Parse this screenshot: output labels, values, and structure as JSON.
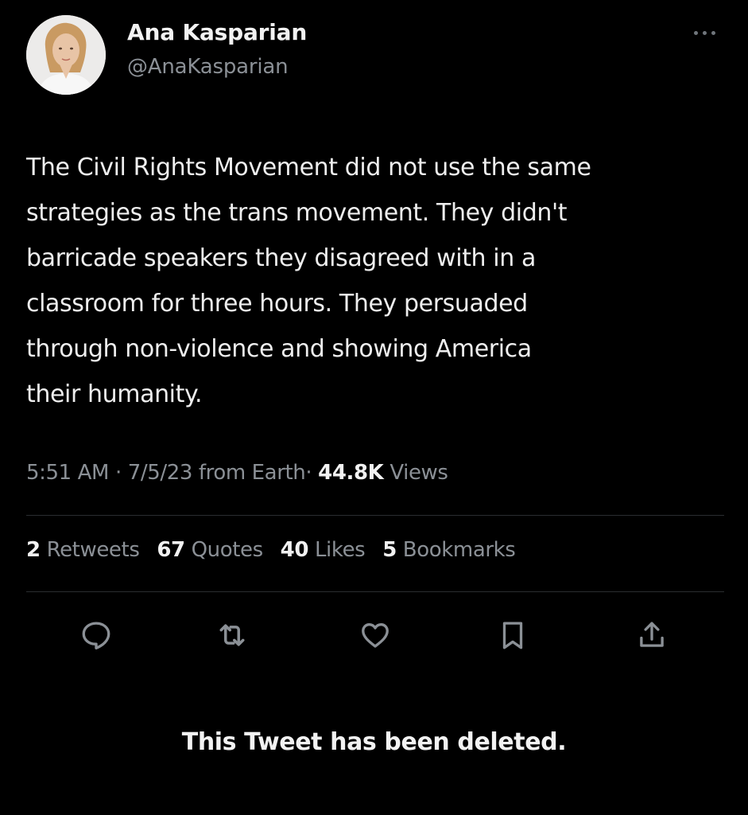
{
  "tweet": {
    "author": {
      "name": "Ana Kasparian",
      "handle": "@AnaKasparian"
    },
    "text": "The Civil Rights Movement did not use the same\nstrategies as the trans movement. They didn't\nbarricade speakers they disagreed with in a\nclassroom for three hours. They persuaded\nthrough non-violence and showing America\ntheir humanity.",
    "meta": {
      "time": "5:51 AM",
      "separator1": "·",
      "date": "7/5/23",
      "source": "from Earth",
      "separator2": "·",
      "views_count": "44.8K",
      "views_label": "Views"
    },
    "stats": [
      {
        "count": "2",
        "label": "Retweets"
      },
      {
        "count": "67",
        "label": "Quotes"
      },
      {
        "count": "40",
        "label": "Likes"
      },
      {
        "count": "5",
        "label": "Bookmarks"
      }
    ],
    "actions": [
      {
        "icon": "reply-icon"
      },
      {
        "icon": "retweet-icon"
      },
      {
        "icon": "like-heart-icon"
      },
      {
        "icon": "bookmark-icon"
      },
      {
        "icon": "share-icon"
      }
    ]
  },
  "deleted_notice": "This Tweet has been deleted.",
  "colors": {
    "background": "#000000",
    "primary_text": "#eeeeee",
    "secondary_text": "#8b9096",
    "divider": "#2a2d30",
    "icon": "#8b9096"
  }
}
